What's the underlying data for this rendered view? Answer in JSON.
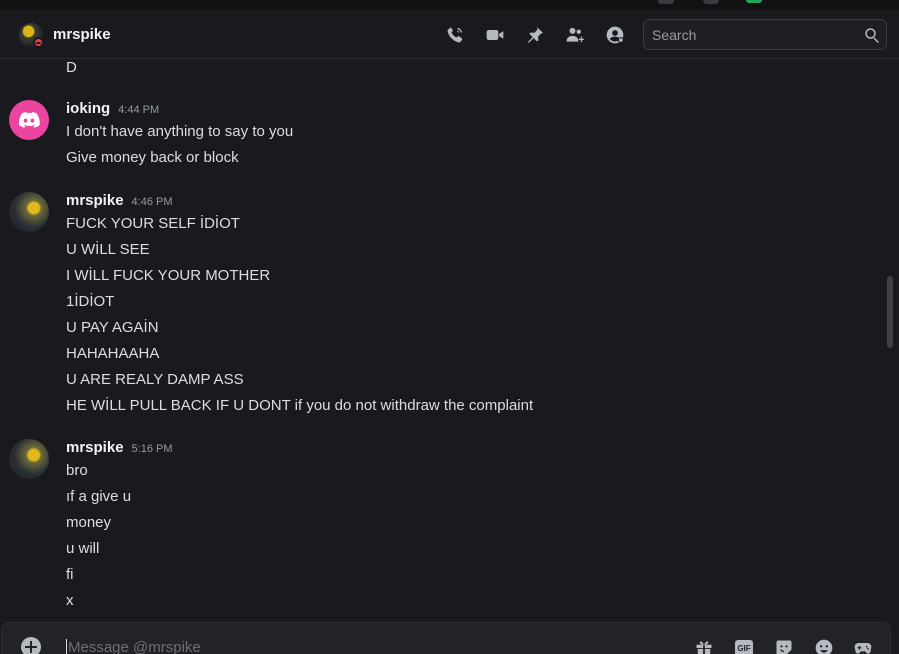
{
  "header": {
    "title": "mrspike",
    "status": "dnd",
    "search_placeholder": "Search"
  },
  "icons": {
    "call": "phone-icon",
    "video": "video-icon",
    "pin": "pin-icon",
    "add_friends": "add-friends-icon",
    "profile": "user-profile-icon",
    "search": "search-icon"
  },
  "stray_line": "D",
  "messages": [
    {
      "username": "ioking",
      "time": "4:44 PM",
      "lines": [
        "I don't have anything to say to you",
        "Give money back or block"
      ]
    },
    {
      "username": "mrspike",
      "time": "4:46 PM",
      "lines": [
        "FUCK YOUR SELF İDİOT",
        "U WİLL SEE",
        "I WİLL FUCK YOUR MOTHER",
        "1İDİOT",
        "U PAY AGAİN",
        "HAHAHAAHA",
        "U ARE REALY DAMP ASS",
        "HE WİLL PULL BACK IF U DONT if you do not withdraw the complaint"
      ]
    },
    {
      "username": "mrspike",
      "time": "5:16 PM",
      "lines": [
        "bro",
        "ıf a give u",
        "money",
        "u will",
        "fi",
        "x"
      ]
    }
  ],
  "composer": {
    "placeholder": "Message @mrspike",
    "gif_label": "GIF"
  },
  "colors": {
    "background": "#1a1a1e",
    "discord_pink": "#eb459f",
    "dnd_red": "#f23f43"
  }
}
